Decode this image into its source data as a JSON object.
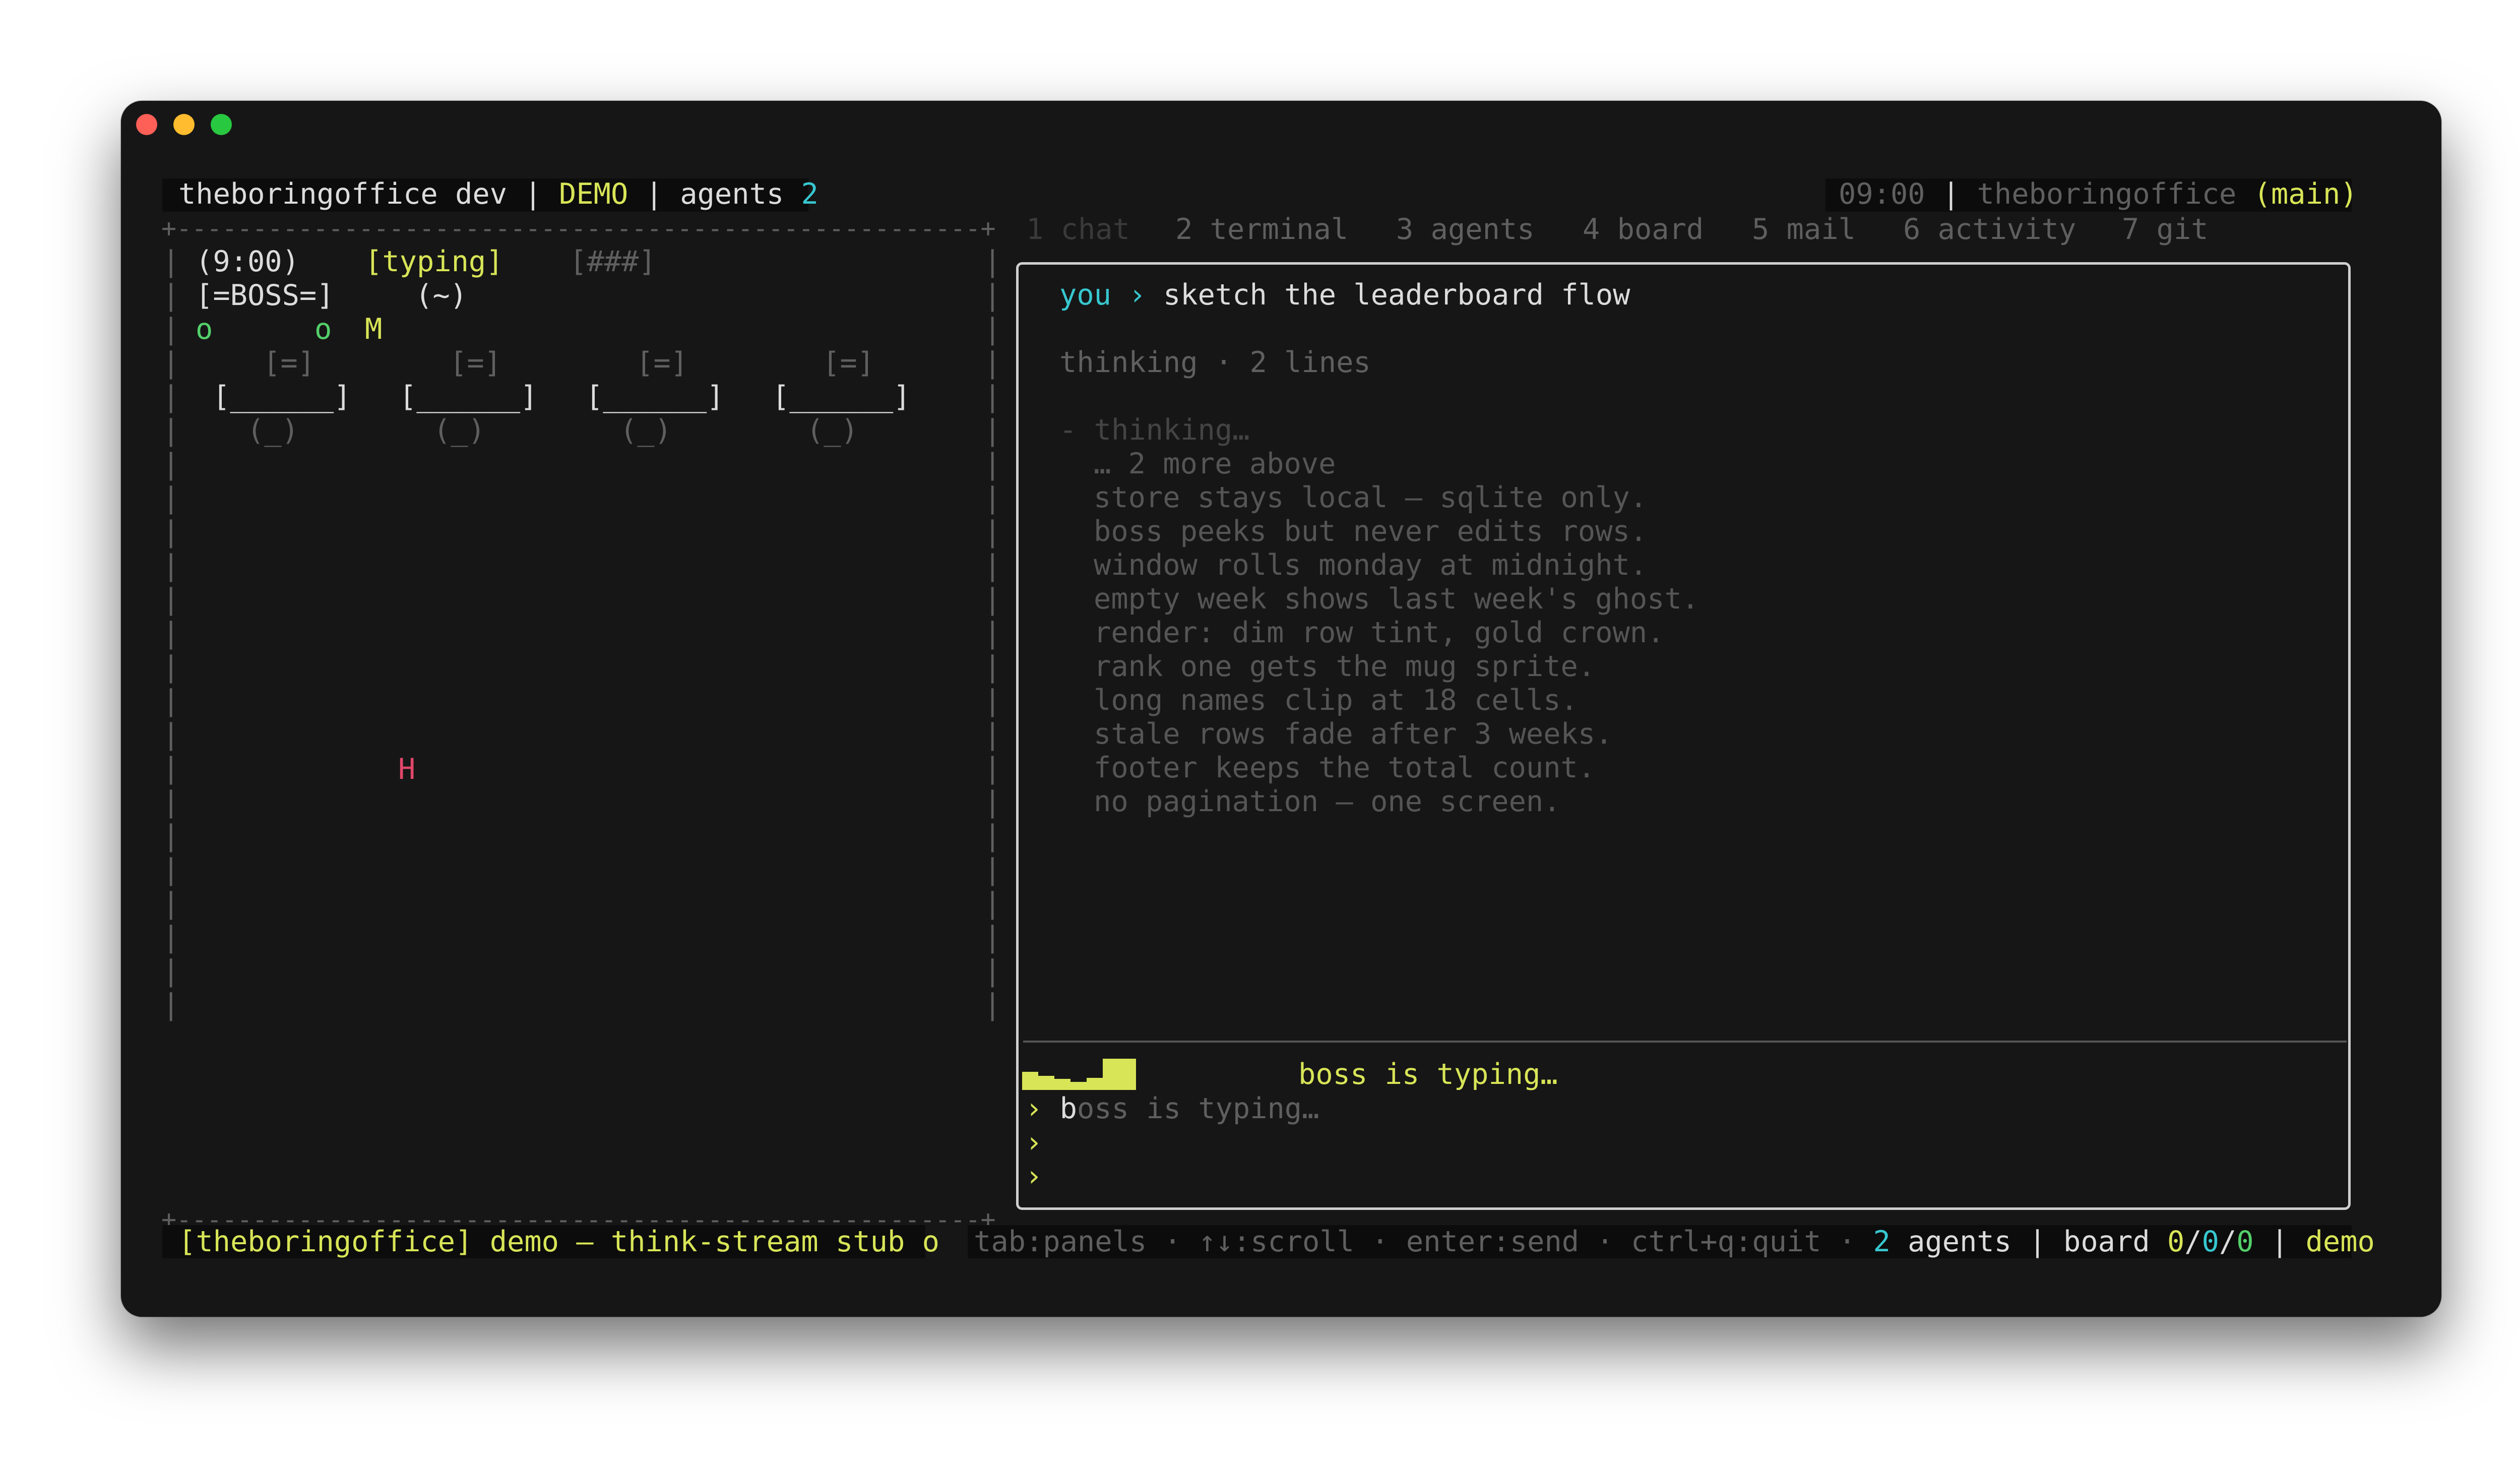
{
  "header": {
    "app_name": "theboringoffice",
    "mode": "dev",
    "sep": "|",
    "badge": "DEMO",
    "agents_label": "agents",
    "agents_count": "2",
    "time": "09:00",
    "repo": "theboringoffice",
    "branch": "(main)"
  },
  "tabs": [
    {
      "label": "1 chat"
    },
    {
      "label": "2 terminal"
    },
    {
      "label": "3 agents"
    },
    {
      "label": "4 board"
    },
    {
      "label": "5 mail"
    },
    {
      "label": "6 activity"
    },
    {
      "label": "7 git"
    }
  ],
  "office": {
    "border_top": "+-----------------------------------------------------+",
    "border_bottom": "+-----------------------------------------------------+",
    "clock": "(9:00)",
    "status": "[typing]",
    "progress": "[###]",
    "boss_desk": "[=BOSS=]",
    "boss_face": "(~)",
    "agent_a": "o",
    "agent_b": "o",
    "agent_m": "M",
    "monitor": "[=]",
    "desk": "[______]",
    "chair": "(_)",
    "agent_h": "H",
    "wall": "|"
  },
  "chat": {
    "user_label": "you",
    "prompt_arrow": "›",
    "user_message": "sketch the leaderboard flow",
    "thinking_summary": "thinking · 2 lines",
    "thinking_header": "- thinking…",
    "thinking_lines": [
      "… 2 more above",
      "store stays local — sqlite only.",
      "boss peeks but never edits rows.",
      "window rolls monday at midnight.",
      "empty week shows last week's ghost.",
      "render: dim row tint, gold crown.",
      "rank one gets the mug sprite.",
      "long names clip at 18 cells.",
      "stale rows fade after 3 weeks.",
      "footer keeps the total count.",
      "no pagination — one screen."
    ],
    "typing_status": "boss is typing…",
    "input_arrow": "›",
    "input_cursor_char": "b",
    "input_placeholder": "oss is typing…",
    "empty_prompt_1": "›",
    "empty_prompt_2": "›"
  },
  "footer": {
    "left_status": "[theboringoffice] demo — think-stream stub o",
    "hints": "tab:panels · ↑↓:scroll · enter:send · ctrl+q:quit ·",
    "agents_count": "2",
    "agents_label": "agents",
    "sep": "|",
    "board_label": "board",
    "board_a": "0",
    "board_slash1": "/",
    "board_b": "0",
    "board_slash2": "/",
    "board_c": "0",
    "sep2": "|",
    "env": "demo"
  },
  "colors": {
    "background": "#161616",
    "accent_yellow": "#d8e557",
    "accent_cyan": "#37c7cf",
    "accent_green": "#53d06a",
    "accent_red": "#e0476a"
  }
}
